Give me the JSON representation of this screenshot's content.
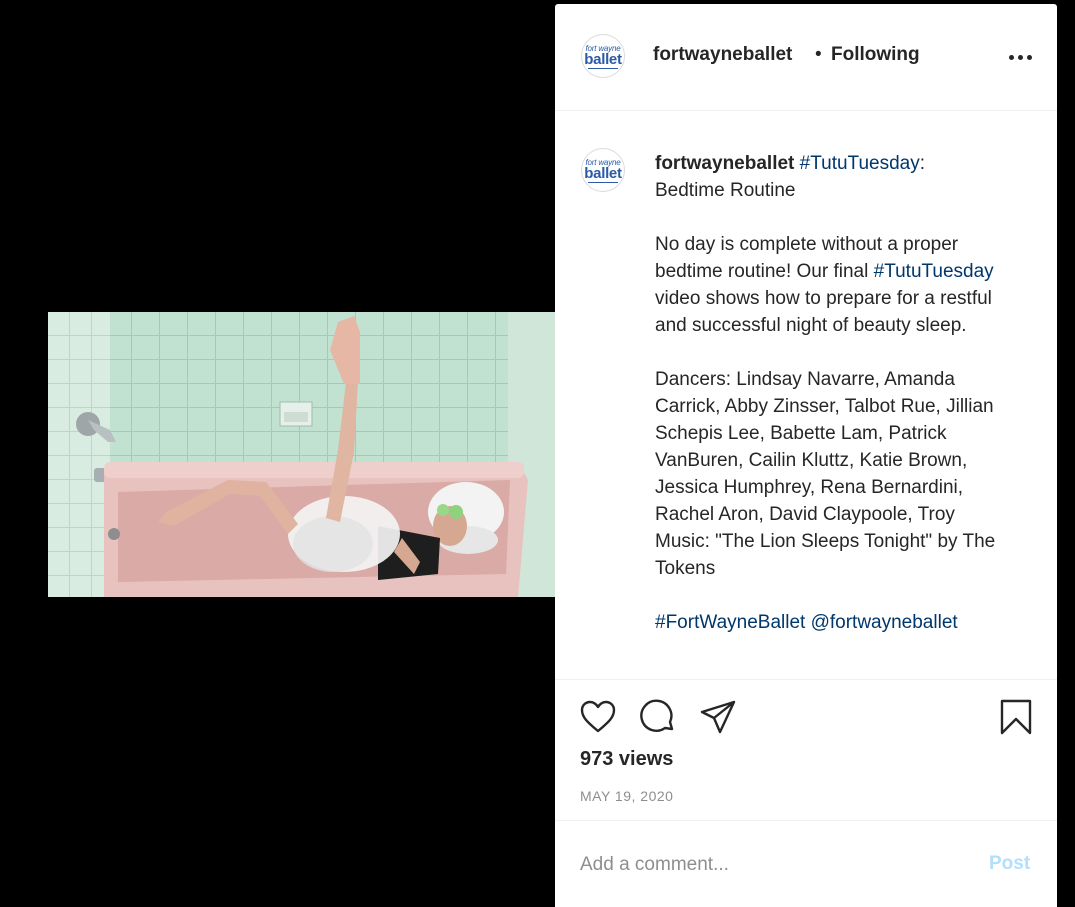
{
  "account": {
    "username": "fortwayneballet",
    "avatar_text_top": "fort wayne",
    "avatar_text_main": "ballet"
  },
  "header": {
    "separator": "•",
    "follow_status": "Following",
    "more_icon": "more-horizontal-icon"
  },
  "caption": {
    "username": "fortwayneballet",
    "title_tag": "#TutuTuesday",
    "title_rest": ":\nBedtime Routine\n\nNo day is complete without a proper bedtime routine! Our final ",
    "body_tag": "#TutuTuesday",
    "body_rest": " video shows how to prepare for a restful and successful night of beauty sleep.\n\nDancers: Lindsay Navarre, Amanda Carrick, Abby Zinsser, Talbot Rue, Jillian Schepis Lee, Babette Lam, Patrick VanBuren, Cailin Kluttz, Katie Brown, Jessica Humphrey, Rena Bernardini, Rachel Aron, David Claypoole, Troy\nMusic: \"The Lion Sleeps Tonight\" by The Tokens\n\n",
    "footer_tags": "#FortWayneBallet @fortwayneballet"
  },
  "actions": {
    "like_icon": "heart-icon",
    "comment_icon": "comment-icon",
    "share_icon": "paper-plane-icon",
    "save_icon": "bookmark-icon"
  },
  "stats": {
    "views": "973 views",
    "date": "MAY 19, 2020"
  },
  "comment": {
    "placeholder": "Add a comment...",
    "post_label": "Post"
  },
  "colors": {
    "text": "#262626",
    "hashtag": "#00376b",
    "muted": "#8e8e8e",
    "post_disabled": "#b2dffc",
    "brand": "#2b5aa8"
  }
}
